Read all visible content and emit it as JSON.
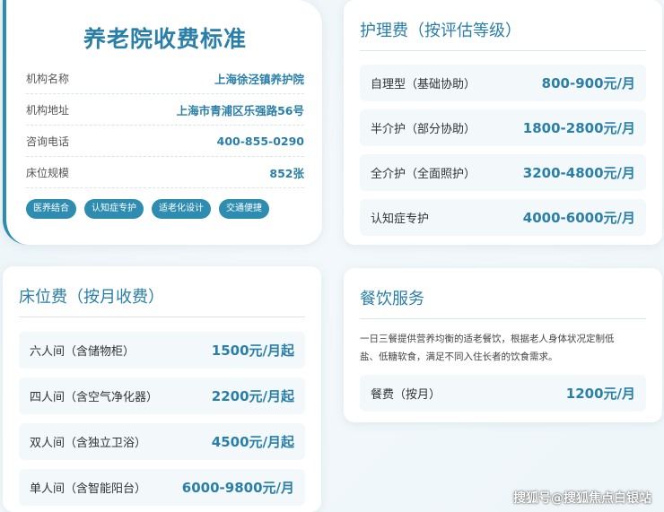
{
  "institution": {
    "title": "养老院收费标准",
    "rows": [
      {
        "label": "机构名称",
        "value": "上海徐泾镇养护院"
      },
      {
        "label": "机构地址",
        "value": "上海市青浦区乐强路56号"
      },
      {
        "label": "咨询电话",
        "value": "400-855-0290"
      },
      {
        "label": "床位规模",
        "value": "852张"
      }
    ],
    "tags": [
      "医养结合",
      "认知症专护",
      "适老化设计",
      "交通便捷"
    ]
  },
  "care_fee": {
    "title": "护理费（按评估等级）",
    "items": [
      {
        "label": "自理型（基础协助）",
        "price": "800-900元/月"
      },
      {
        "label": "半介护（部分协助）",
        "price": "1800-2800元/月"
      },
      {
        "label": "全介护（全面照护）",
        "price": "3200-4800元/月"
      },
      {
        "label": "认知症专护",
        "price": "4000-6000元/月"
      }
    ]
  },
  "bed_fee": {
    "title": "床位费（按月收费）",
    "items": [
      {
        "label": "六人间（含储物柜）",
        "price": "1500元/月起"
      },
      {
        "label": "四人间（含空气净化器）",
        "price": "2200元/月起"
      },
      {
        "label": "双人间（含独立卫浴）",
        "price": "4500元/月起"
      },
      {
        "label": "单人间（含智能阳台）",
        "price": "6000-9800元/月"
      }
    ]
  },
  "food": {
    "title": "餐饮服务",
    "desc_line1": "一日三餐提供营养均衡的适老餐饮，根据老人身体状况定制低",
    "desc_line2": "盐、低糖软食，满足不同入住长者的饮食需求。",
    "item": {
      "label": "餐费（按月）",
      "price": "1200元/月"
    }
  },
  "watermark": "搜狐号@搜狐焦点白银站",
  "colors": {
    "accent": "#2e8cb0",
    "price_text": "#2a7fa8",
    "row_bg": "#f3f8fb"
  }
}
